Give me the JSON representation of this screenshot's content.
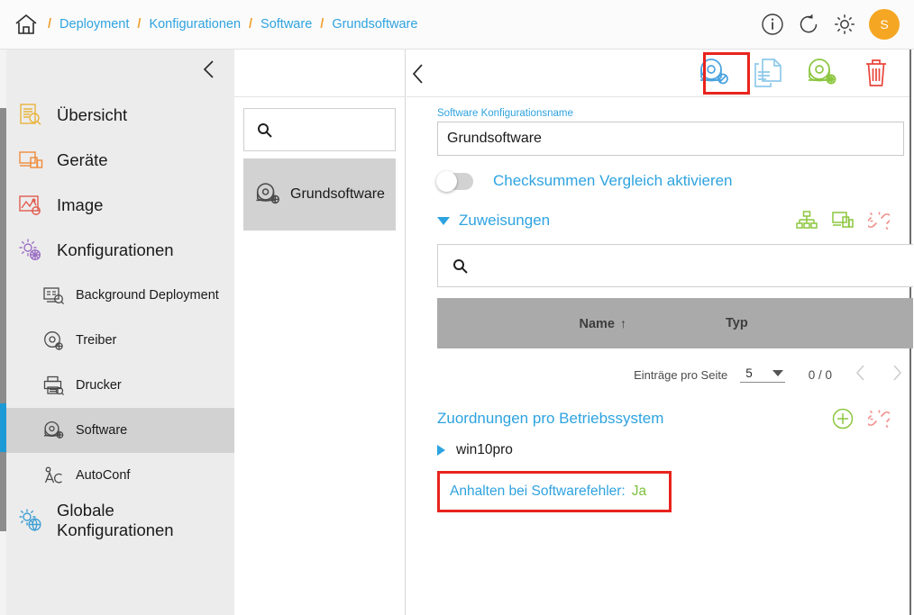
{
  "topbar": {
    "home_icon": "home-icon",
    "breadcrumb": [
      {
        "label": "Deployment"
      },
      {
        "label": "Konfigurationen"
      },
      {
        "label": "Software"
      },
      {
        "label": "Grundsoftware"
      }
    ],
    "separator": "/",
    "actions": [
      {
        "icon": "info-icon"
      },
      {
        "icon": "refresh-icon"
      },
      {
        "icon": "gear-icon"
      }
    ],
    "avatar_initial": "S"
  },
  "sidebar": {
    "collapse_icon": "chevron-left-icon",
    "items": [
      {
        "label": "Übersicht",
        "icon": "overview-icon",
        "level": 0,
        "selected": false
      },
      {
        "label": "Geräte",
        "icon": "devices-icon",
        "level": 0,
        "selected": false
      },
      {
        "label": "Image",
        "icon": "image-icon",
        "level": 0,
        "selected": false
      },
      {
        "label": "Konfigurationen",
        "icon": "configurations-icon",
        "level": 0,
        "selected": false
      },
      {
        "label": "Background Deployment",
        "icon": "background-deployment-icon",
        "level": 1,
        "selected": false
      },
      {
        "label": "Treiber",
        "icon": "driver-icon",
        "level": 1,
        "selected": false
      },
      {
        "label": "Drucker",
        "icon": "printer-icon",
        "level": 1,
        "selected": false
      },
      {
        "label": "Software",
        "icon": "software-disc-icon",
        "level": 1,
        "selected": true
      },
      {
        "label": "AutoConf",
        "icon": "autoconf-icon",
        "level": 1,
        "selected": false
      },
      {
        "label": "Globale Konfigurationen",
        "icon": "global-configurations-icon",
        "level": 0,
        "selected": false
      }
    ]
  },
  "list_panel": {
    "collapse_icon": "chevron-left-icon",
    "search": {
      "icon": "search-icon",
      "value": "",
      "placeholder": ""
    },
    "items": [
      {
        "label": "Grundsoftware",
        "icon": "software-disc-icon",
        "selected": true
      }
    ]
  },
  "detail": {
    "back_icon": "chevron-left-icon",
    "toolbar": [
      {
        "icon": "software-disc-blue-icon",
        "name": "software-config-button",
        "highlighted": true
      },
      {
        "icon": "copy-documents-icon",
        "name": "duplicate-button",
        "highlighted": false
      },
      {
        "icon": "software-disc-gear-green-icon",
        "name": "software-settings-button",
        "highlighted": false
      },
      {
        "icon": "trash-icon",
        "name": "delete-button",
        "highlighted": false
      }
    ],
    "config_name": {
      "label": "Software Konfigurationsname",
      "value": "Grundsoftware",
      "placeholder": ""
    },
    "checksum_toggle": {
      "label": "Checksummen Vergleich aktivieren",
      "state": "off"
    },
    "assignments": {
      "title": "Zuweisungen",
      "expanded": true,
      "actions": [
        {
          "icon": "org-chart-green-icon",
          "name": "assign-group-button"
        },
        {
          "icon": "devices-green-icon",
          "name": "assign-device-button"
        },
        {
          "icon": "unlink-pink-icon",
          "name": "unassign-button"
        }
      ],
      "search": {
        "icon": "search-icon",
        "value": "",
        "placeholder": ""
      },
      "columns": [
        "Name",
        "Typ"
      ],
      "sort_column": "Name",
      "sort_direction": "↑",
      "rows": [],
      "pager": {
        "label": "Einträge pro Seite",
        "page_size": "5",
        "count": "0 / 0",
        "prev_icon": "chevron-left-icon",
        "next_icon": "chevron-right-icon"
      }
    },
    "os_assignments": {
      "title": "Zuordnungen pro Betriebssystem",
      "actions": [
        {
          "icon": "plus-circle-green-icon",
          "name": "add-os-assignment-button"
        },
        {
          "icon": "unlink-pink-icon",
          "name": "remove-os-assignment-button"
        }
      ],
      "items": [
        {
          "label": "win10pro",
          "expanded": false
        }
      ]
    },
    "halt_on_error": {
      "label": "Anhalten bei Softwarefehler:",
      "value": "Ja",
      "highlighted": true
    }
  },
  "colors": {
    "link_blue": "#2ea3e0",
    "accent_orange": "#f5a623",
    "annotation_red": "#e8241d",
    "value_green": "#7dc242",
    "selection_gray": "#d2d2d2",
    "sidebar_gray": "#ececec",
    "active_bar_blue": "#1c9ad6"
  }
}
